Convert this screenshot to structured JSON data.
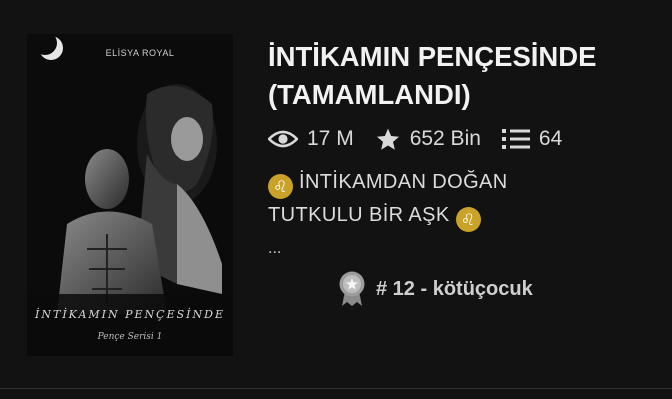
{
  "book": {
    "title": "İNTİKAMIN PENÇESİNDE (TAMAMLANDI)",
    "cover": {
      "author": "ELİSYA ROYAL",
      "title": "İNTİKAMIN PENÇESİNDE",
      "series": "Pençe Serisi 1"
    },
    "stats": {
      "reads": "17 M",
      "votes": "652 Bin",
      "parts": "64"
    },
    "description": {
      "line1": "İNTİKAMDAN DOĞAN",
      "line2": "TUTKULU BİR AŞK",
      "emoji": "♌",
      "ellipsis": "..."
    },
    "ranking": {
      "text": "# 12 - kötüçocuk"
    }
  },
  "icons": {
    "reads": "eye-icon",
    "votes": "star-icon",
    "parts": "list-icon",
    "ranking": "award-badge-icon"
  },
  "colors": {
    "background": "#121212",
    "text": "#e6e6e6",
    "emoji_bg": "#c9a227"
  }
}
